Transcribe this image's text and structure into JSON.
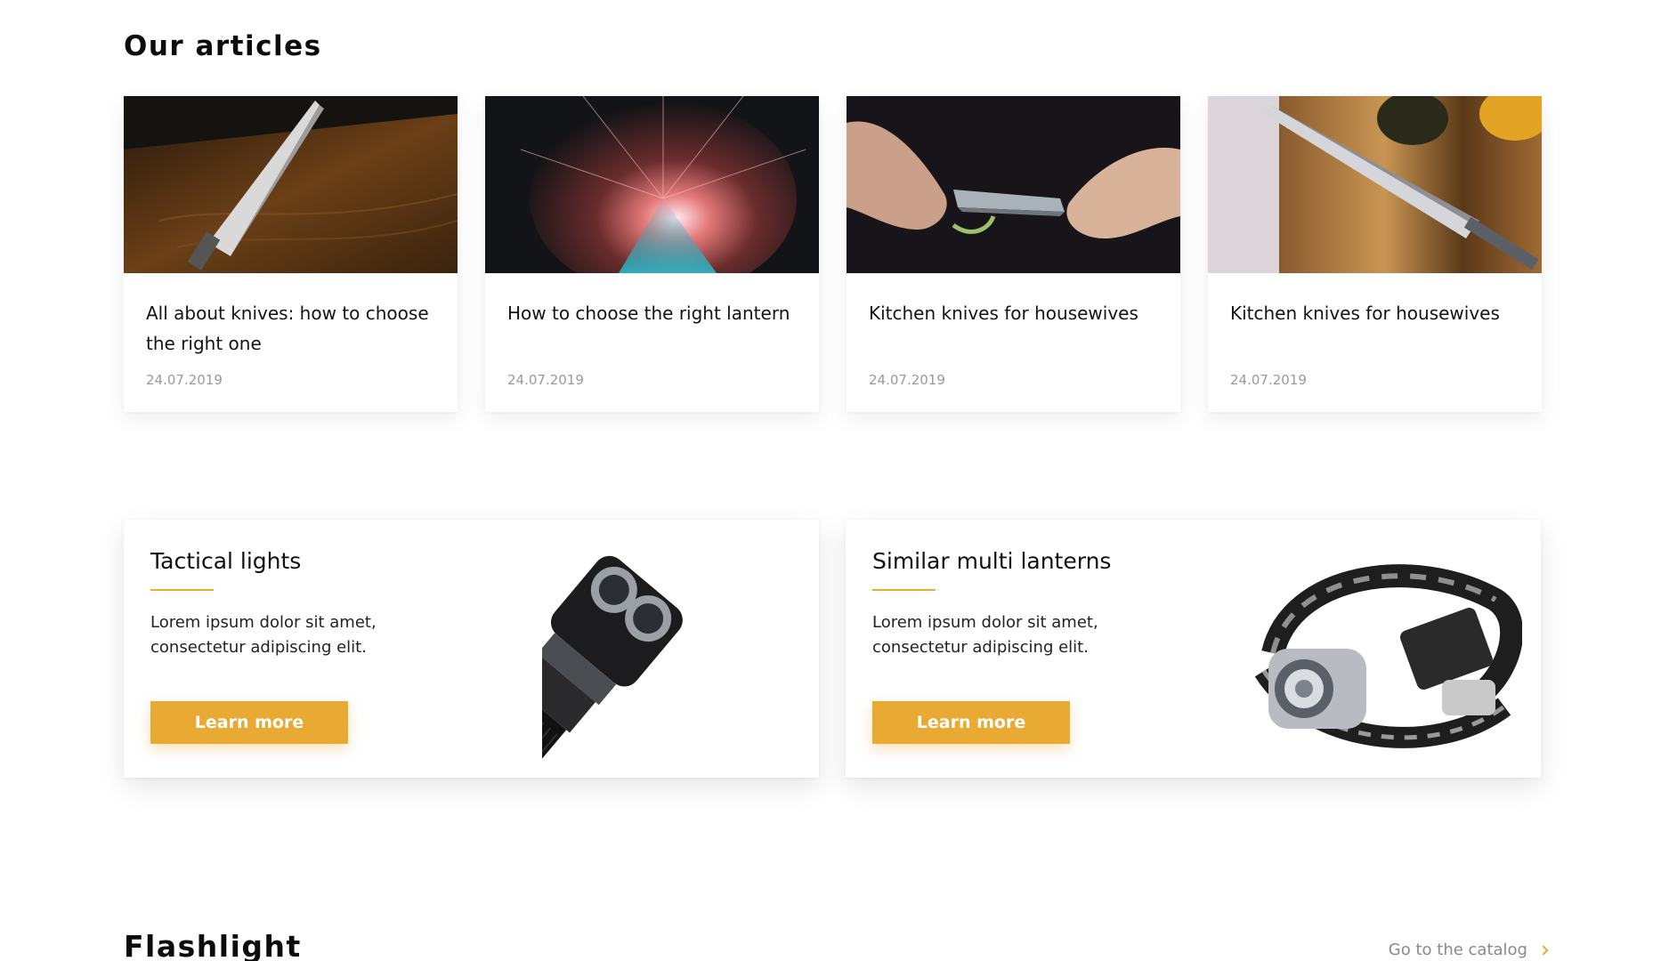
{
  "articles": {
    "title": "Our articles",
    "items": [
      {
        "title": "All about knives: how to choose the right one",
        "date": "24.07.2019",
        "image": "knife-on-wood-photo"
      },
      {
        "title": "How to choose the right lantern",
        "date": "24.07.2019",
        "image": "light-burst-photo"
      },
      {
        "title": "Kitchen knives for housewives",
        "date": "24.07.2019",
        "image": "hands-sharpening-knife-photo"
      },
      {
        "title": "Kitchen knives for housewives",
        "date": "24.07.2019",
        "image": "chef-knife-cutting-board-photo"
      }
    ]
  },
  "promos": [
    {
      "title": "Tactical lights",
      "description": "Lorem ipsum dolor sit amet, consectetur adipiscing elit.",
      "button": "Learn more",
      "image": "tactical-flashlight"
    },
    {
      "title": "Similar multi lanterns",
      "description": "Lorem ipsum dolor sit amet, consectetur adipiscing elit.",
      "button": "Learn more",
      "image": "headlamp"
    }
  ],
  "flashlight": {
    "title": "Flashlight",
    "catalog_link": "Go to the catalog",
    "link_icon": "chevron-right-icon"
  },
  "colors": {
    "accent": "#e9aa34",
    "date": "#9a9a9a",
    "link": "#8a8a8a"
  }
}
